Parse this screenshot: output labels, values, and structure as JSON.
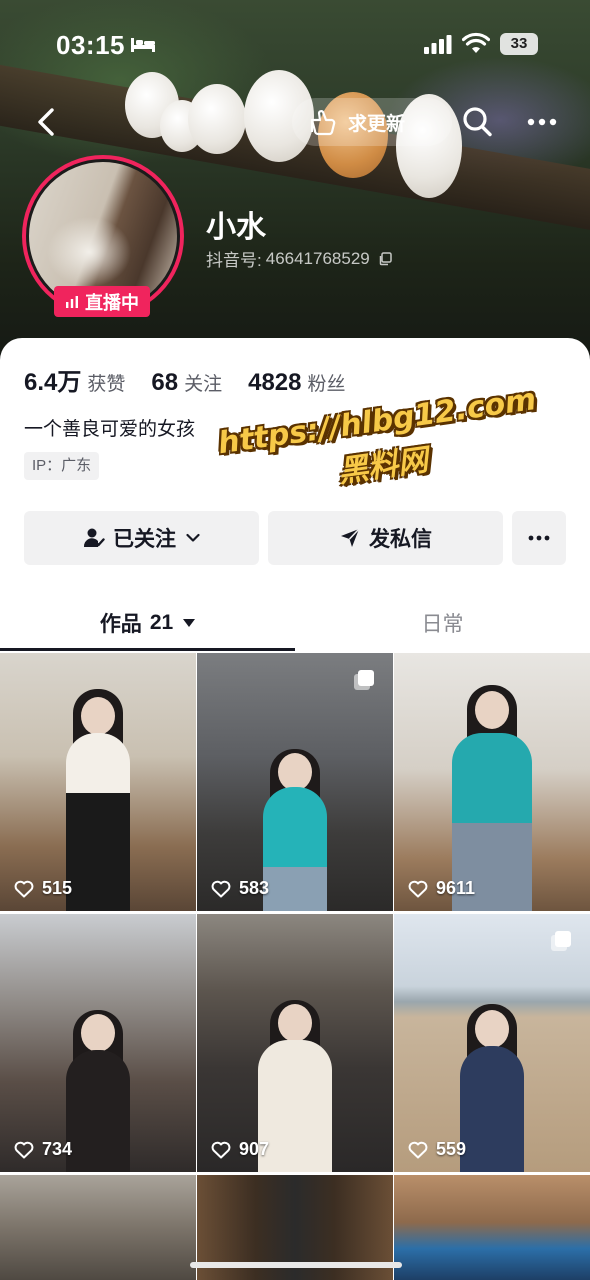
{
  "status_bar": {
    "time": "03:15",
    "battery": "33"
  },
  "header": {
    "seek_update_label": "求更新"
  },
  "profile": {
    "name": "小水",
    "douyin_id_label": "抖音号:",
    "douyin_id": "46641768529",
    "live_badge": "直播中",
    "live_color": "#f0245d"
  },
  "stats": [
    {
      "value": "6.4万",
      "label": "获赞"
    },
    {
      "value": "68",
      "label": "关注"
    },
    {
      "value": "4828",
      "label": "粉丝"
    }
  ],
  "bio": "一个善良可爱的女孩",
  "ip_tag": "IP：广东",
  "watermark": {
    "line1": "https://hlbg12.com",
    "line2": "黑料网"
  },
  "actions": {
    "follow": "已关注",
    "message": "发私信"
  },
  "tabs": {
    "works": "作品",
    "works_count": "21",
    "daily": "日常"
  },
  "grid": [
    {
      "likes": "515",
      "multi": false
    },
    {
      "likes": "583",
      "multi": true
    },
    {
      "likes": "9611",
      "multi": false
    },
    {
      "likes": "734",
      "multi": false
    },
    {
      "likes": "907",
      "multi": false
    },
    {
      "likes": "559",
      "multi": true
    }
  ]
}
